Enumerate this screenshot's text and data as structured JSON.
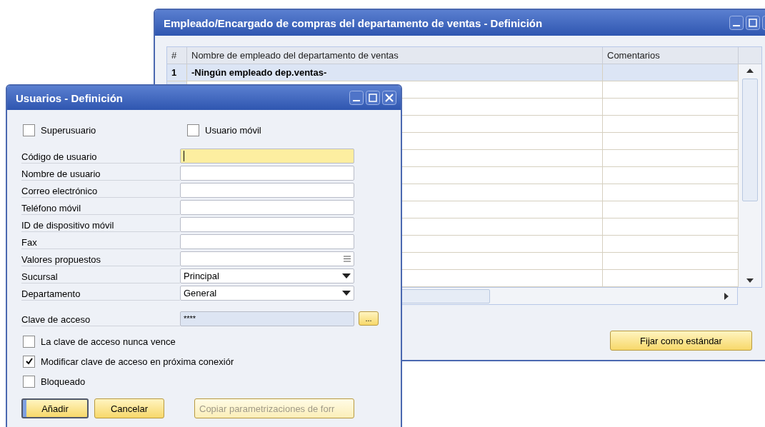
{
  "windows": [
    {
      "title": "Empleado/Encargado de compras del departamento de ventas - Definición",
      "table": {
        "columns": [
          "#",
          "Nombre de empleado del departamento de ventas",
          "Comentarios"
        ],
        "rows": [
          {
            "number": "1",
            "name": "-Ningún empleado dep.ventas-",
            "selected": true
          },
          {
            "selected": false
          },
          {
            "selected": false
          },
          {
            "selected": false
          },
          {
            "selected": false
          },
          {
            "selected": false
          },
          {
            "selected": false
          },
          {
            "selected": false
          },
          {
            "selected": false
          },
          {
            "selected": false
          },
          {
            "selected": false
          },
          {
            "selected": false
          },
          {
            "selected": false
          }
        ]
      },
      "buttons": [
        {
          "label": "Fijar como estándar",
          "default": false,
          "disabled": false
        }
      ]
    },
    {
      "title": "Usuarios - Definición",
      "top_checkboxes": [
        {
          "label": "Superusuario",
          "checked": false
        },
        {
          "label": "Usuario móvil",
          "checked": false
        }
      ],
      "fields": [
        {
          "label": "Código de usuario",
          "kind": "text",
          "focused": true
        },
        {
          "label": "Nombre de usuario",
          "kind": "text",
          "focused": false
        },
        {
          "label": "Correo electrónico",
          "kind": "text",
          "focused": false
        },
        {
          "label": "Teléfono móvil",
          "kind": "text",
          "focused": false
        },
        {
          "label": "ID de dispositivo móvil",
          "kind": "text",
          "focused": false
        },
        {
          "label": "Fax",
          "kind": "text",
          "focused": false
        },
        {
          "label": "Valores propuestos",
          "kind": "lookup",
          "focused": false
        },
        {
          "label": "Sucursal",
          "kind": "dropdown",
          "value": "Principal",
          "focused": false
        },
        {
          "label": "Departamento",
          "kind": "dropdown",
          "value": "General",
          "focused": false
        },
        {
          "label": "Clave de acceso",
          "kind": "password",
          "value": "****",
          "button": "...",
          "focused": false
        }
      ],
      "checkboxes": [
        {
          "label": "La clave de acceso nunca vence",
          "checked": false
        },
        {
          "label": "Modificar clave de acceso en próxima conexiór",
          "checked": true
        },
        {
          "label": "Bloqueado",
          "checked": false
        }
      ],
      "buttons": [
        {
          "label": "Añadir",
          "default": true,
          "disabled": false
        },
        {
          "label": "Cancelar",
          "default": false,
          "disabled": false
        },
        {
          "label": "Copiar parametrizaciones de forr",
          "default": false,
          "disabled": true
        }
      ]
    }
  ]
}
